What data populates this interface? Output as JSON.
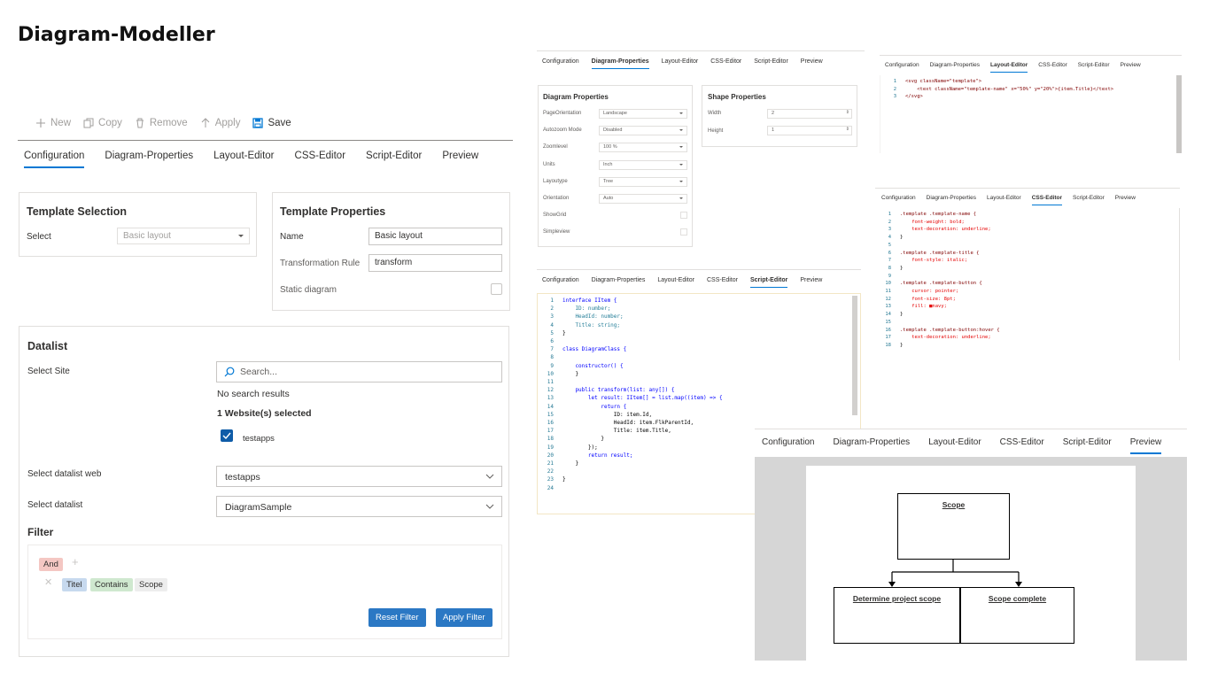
{
  "app_title": "Diagram-Modeller",
  "toolbar": {
    "new": "New",
    "copy": "Copy",
    "remove": "Remove",
    "apply": "Apply",
    "save": "Save"
  },
  "tabs": [
    "Configuration",
    "Diagram-Properties",
    "Layout-Editor",
    "CSS-Editor",
    "Script-Editor",
    "Preview"
  ],
  "template_selection": {
    "title": "Template Selection",
    "select_label": "Select",
    "select_value": "Basic layout"
  },
  "template_properties": {
    "title": "Template Properties",
    "name_label": "Name",
    "name_value": "Basic layout",
    "rule_label": "Transformation Rule",
    "rule_value": "transform",
    "static_label": "Static diagram"
  },
  "datalist": {
    "title": "Datalist",
    "site_label": "Select Site",
    "search_placeholder": "Search...",
    "no_results": "No search results",
    "selected_count": "1 Website(s) selected",
    "site_item": "testapps",
    "web_label": "Select datalist web",
    "web_value": "testapps",
    "list_label": "Select datalist",
    "list_value": "DiagramSample"
  },
  "filter": {
    "title": "Filter",
    "operator": "And",
    "field": "Titel",
    "condition": "Contains",
    "value": "Scope",
    "reset": "Reset Filter",
    "apply": "Apply Filter"
  },
  "diagram_properties": {
    "title": "Diagram Properties",
    "rows": [
      {
        "label": "PageOrientation",
        "value": "Landscape"
      },
      {
        "label": "Autozoom Mode",
        "value": "Disabled"
      },
      {
        "label": "Zoomlevel",
        "value": "100 %"
      },
      {
        "label": "Units",
        "value": "Inch"
      },
      {
        "label": "Layoutype",
        "value": "Tree"
      },
      {
        "label": "Orientation",
        "value": "Auto"
      },
      {
        "label": "ShowGrid",
        "value": ""
      },
      {
        "label": "Simpleview",
        "value": ""
      }
    ]
  },
  "shape_properties": {
    "title": "Shape Properties",
    "width_label": "Width",
    "width_value": "2",
    "height_label": "Height",
    "height_value": "1"
  },
  "layout_code": [
    "<svg className=\"template\">",
    "    <text className=\"template-name\" x=\"50%\" y=\"20%\">{item.Title}</text>",
    "</svg>"
  ],
  "css_code": [
    ".template .template-name {",
    "    font-weight: bold;",
    "    text-decoration: underline;",
    "}",
    "",
    ".template .template-title {",
    "    font-style: italic;",
    "}",
    "",
    ".template .template-button {",
    "    cursor: pointer;",
    "    font-size: 8pt;",
    "    fill: ■navy;",
    "}",
    "",
    ".template .template-button:hover {",
    "    text-decoration: underline;",
    "}"
  ],
  "script_code": [
    "interface IItem {",
    "    ID: number;",
    "    HeadId: number;",
    "    Title: string;",
    "}",
    "",
    "class DiagramClass {",
    "",
    "    constructor() {",
    "    }",
    "",
    "    public transform(list: any[]) {",
    "        let result: IItem[] = list.map((item) => {",
    "            return {",
    "                ID: item.Id,",
    "                HeadId: item.FlkParentId,",
    "                Title: item.Title,",
    "            }",
    "        });",
    "        return result;",
    "    }",
    "",
    "}",
    ""
  ],
  "preview": {
    "root": "Scope",
    "children": [
      "Determine project scope",
      "Scope complete"
    ]
  },
  "colors": {
    "accent": "#0078d4",
    "primary_button": "#2b78c4",
    "and_chip": "#f4c7c3",
    "field_chip": "#c7d9ee",
    "condition_chip": "#cfe8cf",
    "value_chip": "#ededed"
  }
}
